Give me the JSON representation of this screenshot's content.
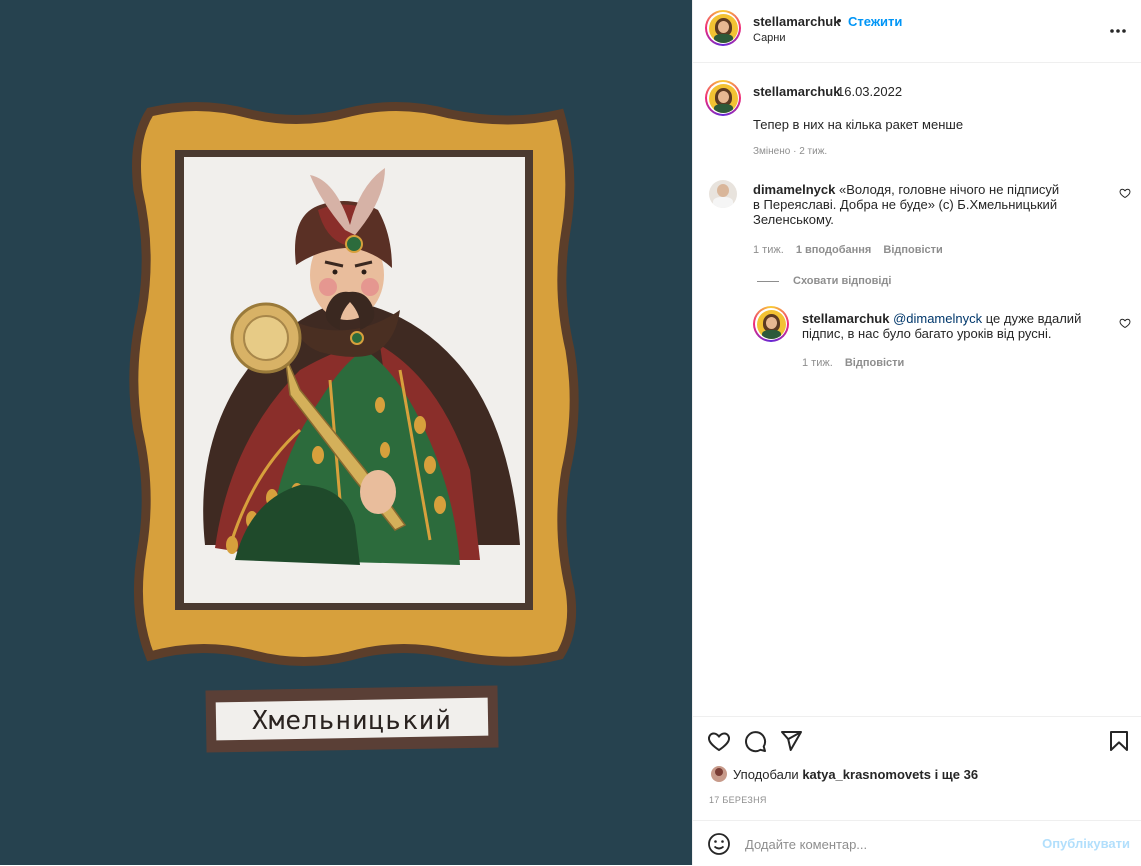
{
  "post": {
    "author": "stellamarchuk",
    "follow_label": "Стежити",
    "separator": "•",
    "location": "Сарни",
    "more_label": "•••"
  },
  "image": {
    "caption_text": "Хмельницький"
  },
  "caption": {
    "username": "stellamarchuk",
    "date": "16.03.2022",
    "text": "Тепер в них на кілька ракет менше",
    "edited": "Змінено · 2 тиж."
  },
  "comments": [
    {
      "username": "dimamelnyck",
      "text": "«Володя, головне нічого не підписуй в Переяславі. Добра не буде» (с) Б.Хмельницький Зеленському.",
      "time": "1 тиж.",
      "likes": "1 вподобання",
      "reply": "Відповісти",
      "hide_replies": "Сховати відповіді",
      "replies": [
        {
          "username": "stellamarchuk",
          "mention": "@dimamelnyck",
          "text": " це дуже вдалий підпис, в нас було багато уроків від русні.",
          "time": "1 тиж.",
          "reply": "Відповісти"
        }
      ]
    }
  ],
  "likes": {
    "prefix": "Уподобали ",
    "user": "katya_krasnomovets",
    "suffix": " і ще 36"
  },
  "post_date": "17 БЕРЕЗНЯ",
  "add_comment": {
    "placeholder": "Додайте коментар...",
    "publish": "Опублікувати"
  },
  "icons": [
    "heart-icon",
    "comment-icon",
    "share-icon",
    "bookmark-icon",
    "emoji-icon",
    "more-icon"
  ]
}
